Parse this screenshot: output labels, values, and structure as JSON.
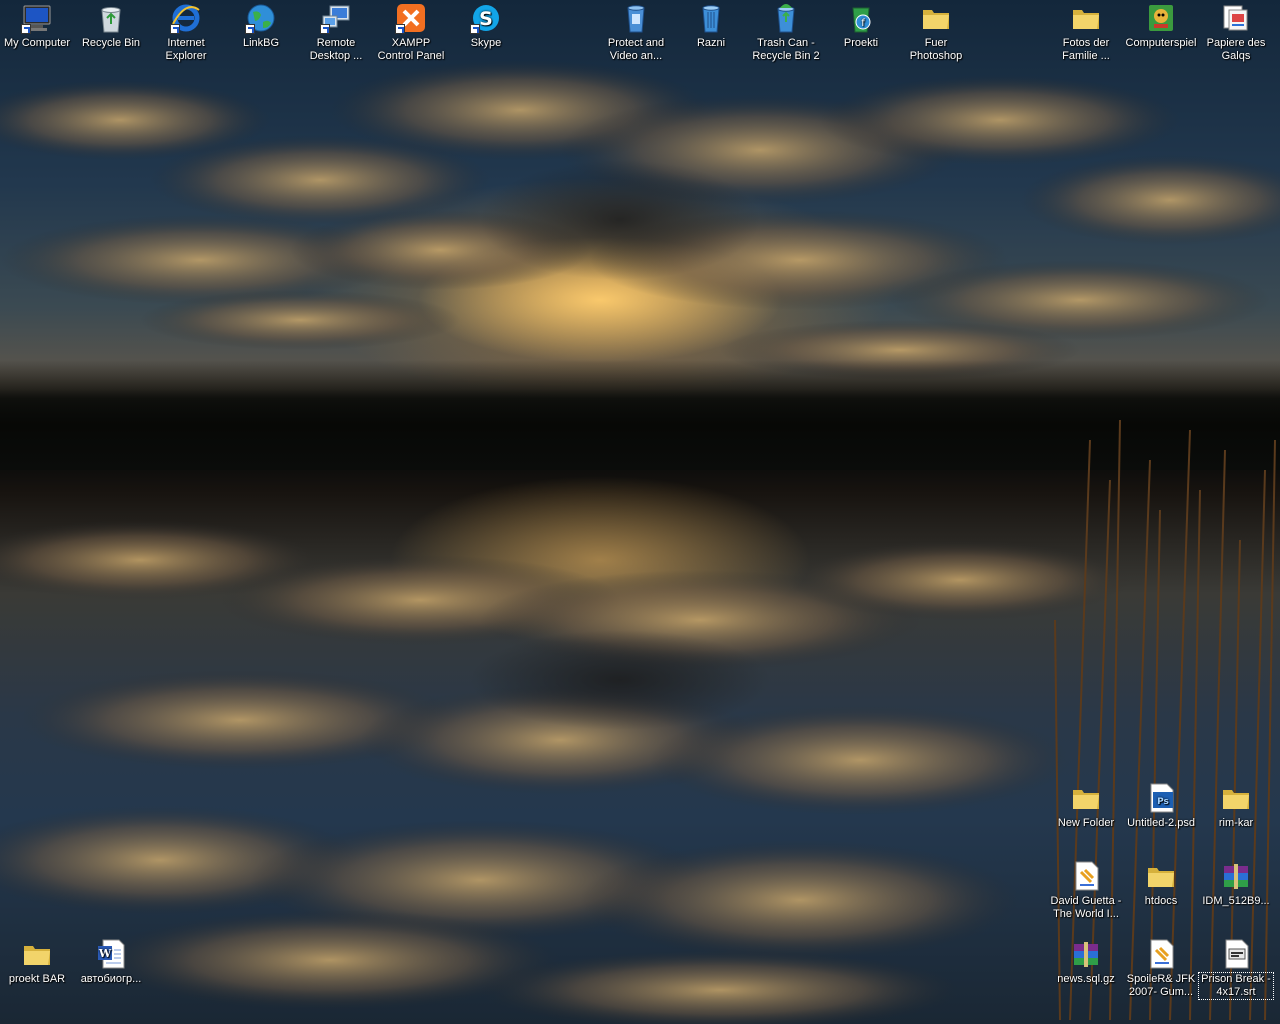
{
  "desktop": {
    "icons_top": [
      {
        "label": "My Computer",
        "icon": "computer-icon"
      },
      {
        "label": "Recycle Bin",
        "icon": "recycle-bin-icon"
      },
      {
        "label": "Internet Explorer",
        "icon": "internet-explorer-icon"
      },
      {
        "label": "LinkBG",
        "icon": "globe-icon"
      },
      {
        "label": "Remote Desktop ...",
        "icon": "remote-desktop-icon"
      },
      {
        "label": "XAMPP Control Panel",
        "icon": "xampp-icon"
      },
      {
        "label": "Skype",
        "icon": "skype-icon"
      },
      {
        "label": "Protect and Video an...",
        "icon": "protect-video-icon"
      },
      {
        "label": "Razni",
        "icon": "trash-can-icon"
      },
      {
        "label": "Trash Can - Recycle Bin 2",
        "icon": "trash-can-full-icon"
      },
      {
        "label": "Proekti",
        "icon": "proekti-icon"
      },
      {
        "label": "Fuer Photoshop",
        "icon": "folder-icon"
      },
      {
        "label": "Fotos der Familie ...",
        "icon": "folder-icon"
      },
      {
        "label": "Computerspiel",
        "icon": "game-icon"
      },
      {
        "label": "Papiere des Galqs",
        "icon": "papers-icon"
      }
    ],
    "icons_bottom": [
      {
        "label": "New Folder",
        "icon": "folder-icon"
      },
      {
        "label": "Untitled-2.psd",
        "icon": "psd-file-icon"
      },
      {
        "label": "rim-kar",
        "icon": "folder-icon"
      },
      {
        "label": "David Guetta - The World I...",
        "icon": "subtitle-file-icon"
      },
      {
        "label": "htdocs",
        "icon": "folder-icon"
      },
      {
        "label": "IDM_512B9...",
        "icon": "winrar-archive-icon"
      },
      {
        "label": "proekt BAR",
        "icon": "folder-icon"
      },
      {
        "label": "автобиогр...",
        "icon": "word-document-icon"
      },
      {
        "label": "news.sql.gz",
        "icon": "winrar-archive-icon"
      },
      {
        "label": "SpoileR& JFK 2007- Gum...",
        "icon": "subtitle-file-icon"
      },
      {
        "label": "Prison Break - 4x17.srt",
        "icon": "srt-file-icon"
      }
    ]
  },
  "colors": {
    "folder": "#f2d46a",
    "folder_dark": "#d6b13c",
    "ie_blue": "#1f6fd6",
    "skype_blue": "#12a5e8",
    "xampp_orange": "#f26f21",
    "psd_blue": "#1c5fb3",
    "label_text": "#ffffff"
  }
}
